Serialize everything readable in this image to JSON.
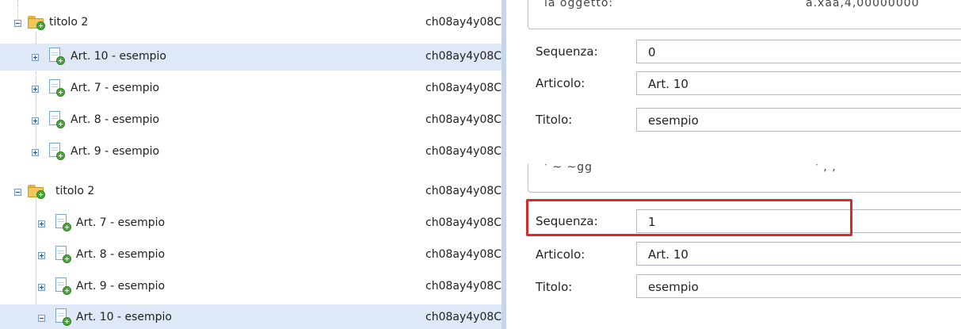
{
  "top": {
    "tree": {
      "parent": {
        "label": "titolo 2",
        "id": "ch08ay4y08C"
      },
      "children": [
        {
          "label": "Art. 10 - esempio",
          "id": "ch08ay4y08C"
        },
        {
          "label": "Art. 7 - esempio",
          "id": "ch08ay4y08C"
        },
        {
          "label": "Art. 8 - esempio",
          "id": "ch08ay4y08C"
        },
        {
          "label": "Art. 9 - esempio",
          "id": "ch08ay4y08C"
        }
      ]
    },
    "form": {
      "group_text_left": "ia oggetto:",
      "group_text_right": "a.xaa,4,00000000",
      "sequenza_label": "Sequenza:",
      "sequenza_value": "0",
      "articolo_label": "Articolo:",
      "articolo_value": "Art. 10",
      "titolo_label": "Titolo:",
      "titolo_value": "esempio"
    }
  },
  "bottom": {
    "tree": {
      "parent": {
        "label": "titolo 2",
        "id": "ch08ay4y08C"
      },
      "children": [
        {
          "label": "Art. 7 - esempio",
          "id": "ch08ay4y08C"
        },
        {
          "label": "Art. 8 - esempio",
          "id": "ch08ay4y08C"
        },
        {
          "label": "Art. 9 - esempio",
          "id": "ch08ay4y08C"
        },
        {
          "label": "Art. 10 - esempio",
          "id": "ch08ay4y08C"
        }
      ]
    },
    "form": {
      "group_text_left": "' ~ ~gg",
      "group_text_right": "' , ,",
      "sequenza_label": "Sequenza:",
      "sequenza_value": "1",
      "articolo_label": "Articolo:",
      "articolo_value": "Art. 10",
      "titolo_label": "Titolo:",
      "titolo_value": "esempio"
    }
  },
  "colors": {
    "highlight": "#d42b2b",
    "selected_row": "#dfe8f6",
    "splitter": "#c5d6ec"
  },
  "icons": [
    "tree-expand-icon",
    "tree-collapse-icon",
    "folder-add-icon",
    "document-add-icon"
  ]
}
